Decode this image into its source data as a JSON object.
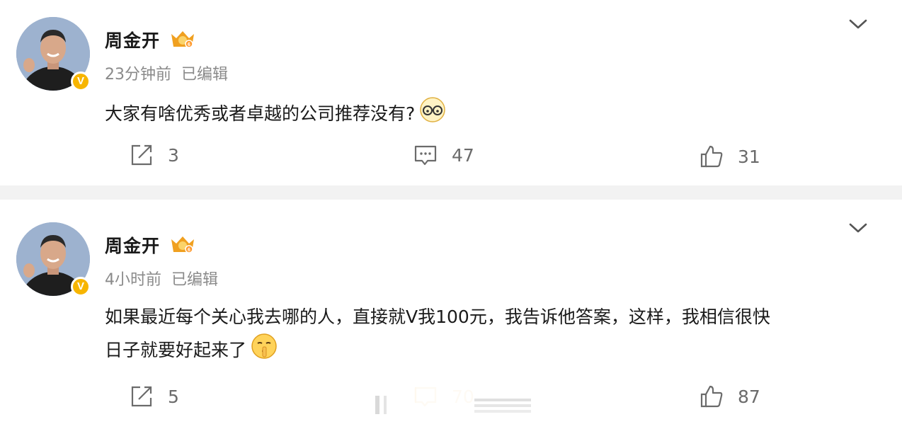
{
  "posts": [
    {
      "username": "周金开",
      "time": "23分钟前",
      "edited": "已编辑",
      "text": "大家有啥优秀或者卓越的公司推荐没有?",
      "reposts": "3",
      "comments": "47",
      "likes": "31",
      "trailing_emoji": "thinking-glasses-emoji"
    },
    {
      "username": "周金开",
      "time": "4小时前",
      "edited": "已编辑",
      "text_line1": "如果最近每个关心我去哪的人，直接就V我100元，我告诉他答案，这样，我相信很快",
      "text_line2": "日子就要好起来了",
      "reposts": "5",
      "comments": "70",
      "likes": "87",
      "trailing_emoji": "shush-emoji"
    }
  ],
  "badge": {
    "verified_letter": "V"
  },
  "colors": {
    "verified": "#f7b500",
    "crown": "#f0a020",
    "meta": "#8a8a8a",
    "comment_highlight": "#f5a623"
  }
}
